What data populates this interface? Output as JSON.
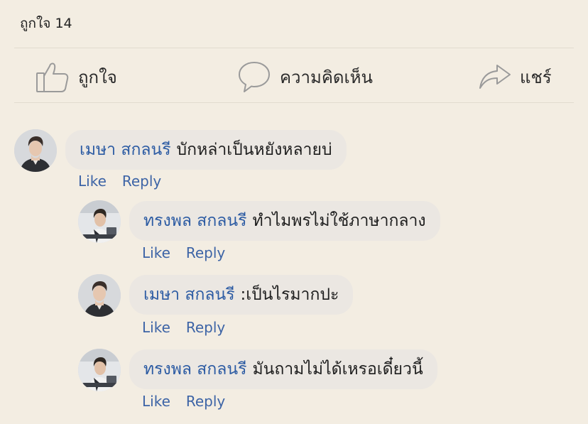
{
  "post": {
    "likes_text": "ถูกใจ 14"
  },
  "actions": {
    "like_label": "ถูกใจ",
    "comment_label": "ความคิดเห็น",
    "share_label": "แชร์"
  },
  "comments": [
    {
      "author": "เมษา สกลนรี",
      "text": "บักหล่าเป็นหยังหลายบ่",
      "like_label": "Like",
      "reply_label": "Reply",
      "replies": [
        {
          "author": "ทรงพล สกลนรี",
          "text": "ทำไมพรไม่ใช้ภาษากลาง",
          "like_label": "Like",
          "reply_label": "Reply"
        },
        {
          "author": "เมษา สกลนรี",
          "text": ":เป็นไรมากปะ",
          "like_label": "Like",
          "reply_label": "Reply"
        },
        {
          "author": "ทรงพล สกลนรี",
          "text": "มันถามไม่ได้เหรอเดี๋ยวนี้",
          "like_label": "Like",
          "reply_label": "Reply"
        }
      ]
    }
  ],
  "icons": {
    "like": "thumbs-up-icon",
    "comment": "speech-bubble-icon",
    "share": "share-arrow-icon"
  },
  "colors": {
    "background": "#f3ede2",
    "bubble": "#ebe7e2",
    "author_link": "#2c5ba3",
    "action_link": "#3d64a6"
  }
}
